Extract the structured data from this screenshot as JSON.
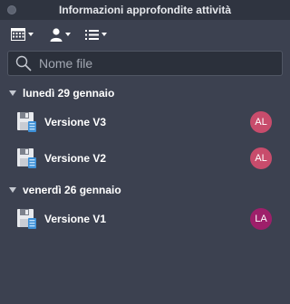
{
  "window": {
    "title": "Informazioni approfondite attività"
  },
  "toolbar": {
    "buttons": [
      {
        "icon": "calendar-icon"
      },
      {
        "icon": "user-icon"
      },
      {
        "icon": "list-icon"
      }
    ]
  },
  "search": {
    "placeholder": "Nome file",
    "value": ""
  },
  "groups": [
    {
      "date": "lunedì 29 gennaio",
      "items": [
        {
          "label": "Versione V3",
          "initials": "AL",
          "color": "#c84c6c"
        },
        {
          "label": "Versione V2",
          "initials": "AL",
          "color": "#c84c6c"
        }
      ]
    },
    {
      "date": "venerdì 26 gennaio",
      "items": [
        {
          "label": "Versione V1",
          "initials": "LA",
          "color": "#9e1f6a"
        }
      ]
    }
  ]
}
